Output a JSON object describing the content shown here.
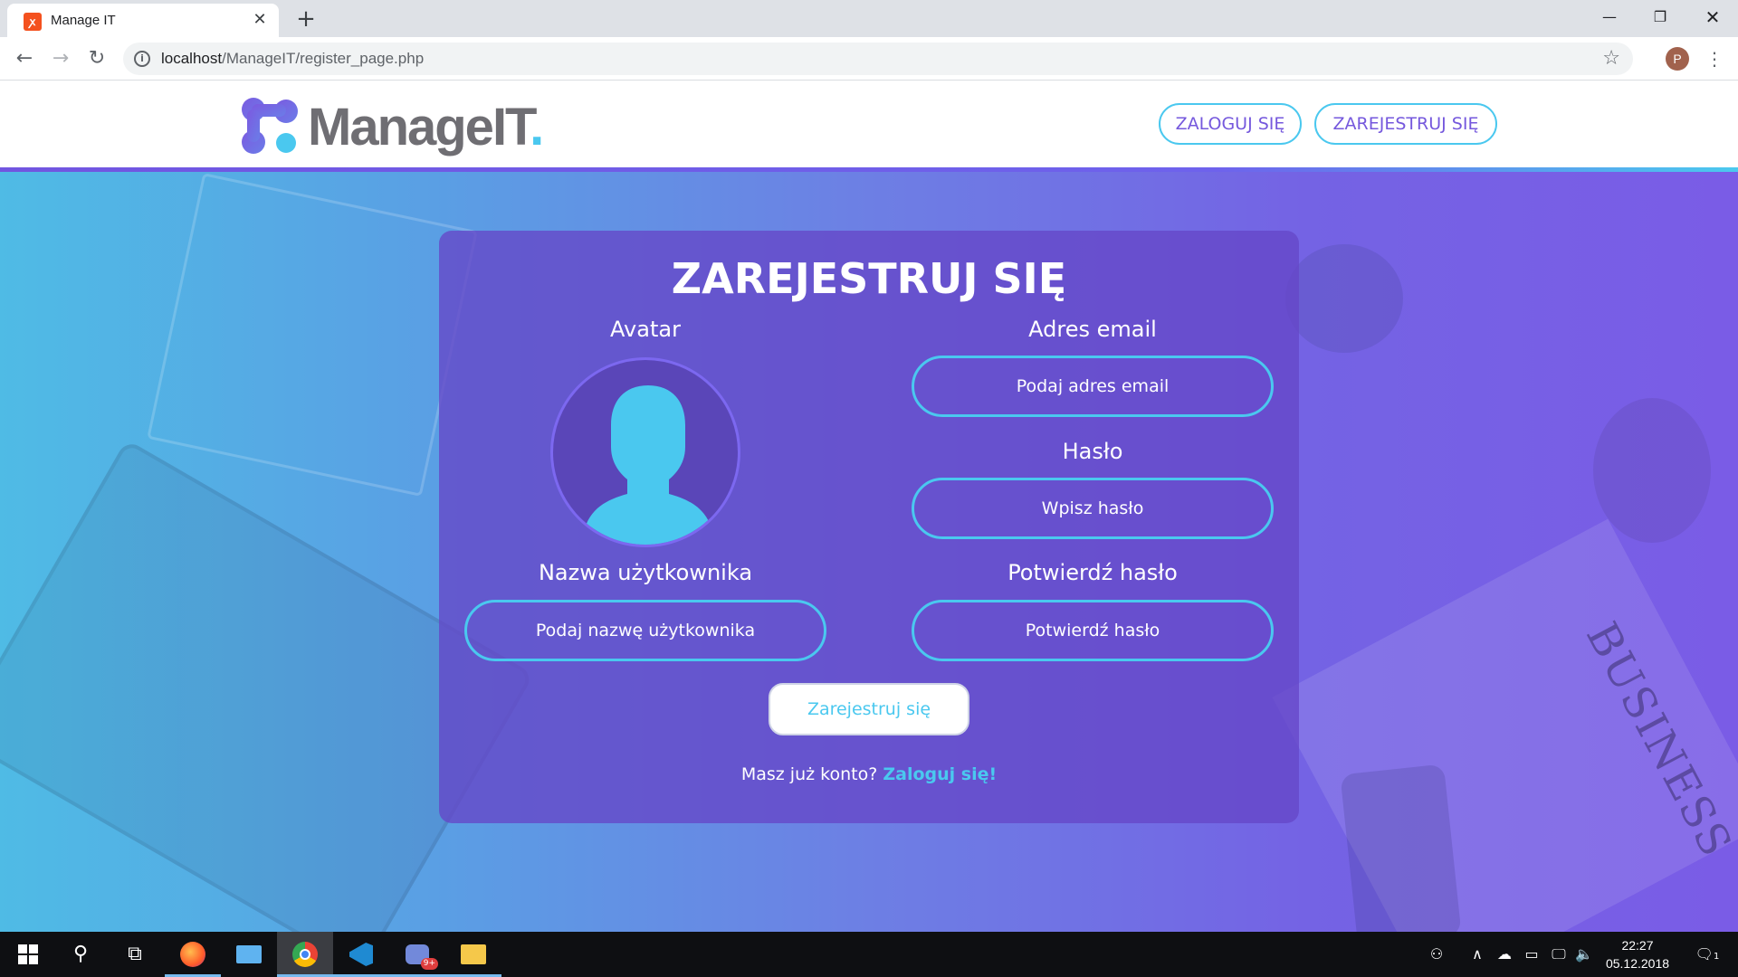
{
  "browser": {
    "tab_title": "Manage IT",
    "tab_close": "✕",
    "new_tab": "+",
    "url_host": "localhost",
    "url_path": "/ManageIT/register_page.php",
    "profile_initial": "P",
    "window": {
      "minimize": "—",
      "maximize": "❐",
      "close": "✕"
    }
  },
  "site": {
    "logo_text": "ManageIT",
    "logo_dot": ".",
    "nav": {
      "login": "ZALOGUJ SIĘ",
      "register": "ZAREJESTRUJ SIĘ"
    },
    "colors": {
      "accent": "#4ac8ef",
      "purple": "#7558dd"
    }
  },
  "form": {
    "title": "ZAREJESTRUJ SIĘ",
    "avatar_label": "Avatar",
    "email_label": "Adres email",
    "email_placeholder": "Podaj adres email",
    "password_label": "Hasło",
    "password_placeholder": "Wpisz hasło",
    "username_label": "Nazwa użytkownika",
    "username_placeholder": "Podaj nazwę użytkownika",
    "confirm_label": "Potwierdź hasło",
    "confirm_placeholder": "Potwierdź hasło",
    "submit": "Zarejestruj się",
    "have_account": "Masz już konto?",
    "login_link": "Zaloguj się!"
  },
  "background": {
    "business_text": "BUSINESS"
  },
  "taskbar": {
    "time": "22:27",
    "date": "05.12.2018",
    "notification_count": "1",
    "badge": "9+"
  }
}
